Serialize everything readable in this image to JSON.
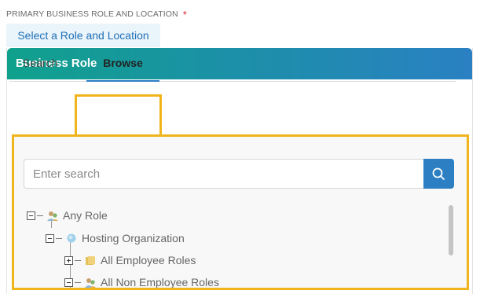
{
  "field": {
    "label": "PRIMARY BUSINESS ROLE AND LOCATION",
    "required_mark": "*"
  },
  "select_button": {
    "label": "Select a Role and Location"
  },
  "panel": {
    "title": "Business Role"
  },
  "tabs": [
    {
      "label": "Search",
      "active": false
    },
    {
      "label": "Browse",
      "active": true
    }
  ],
  "search": {
    "placeholder": "Enter search",
    "value": "",
    "icon": "search-icon"
  },
  "tree": [
    {
      "label": "Any Role",
      "expanded": true,
      "icon": "role-group-icon"
    },
    {
      "label": "Hosting Organization",
      "expanded": true,
      "icon": "organization-icon"
    },
    {
      "label": "All Employee Roles",
      "expanded": false,
      "icon": "folder-icon"
    },
    {
      "label": "All Non Employee Roles",
      "expanded": true,
      "icon": "role-group-icon"
    }
  ],
  "colors": {
    "accent": "#2b7fc2",
    "highlight": "#f0b41c",
    "header_start": "#10a18c",
    "header_end": "#2a80c2",
    "required": "#d9262b"
  }
}
